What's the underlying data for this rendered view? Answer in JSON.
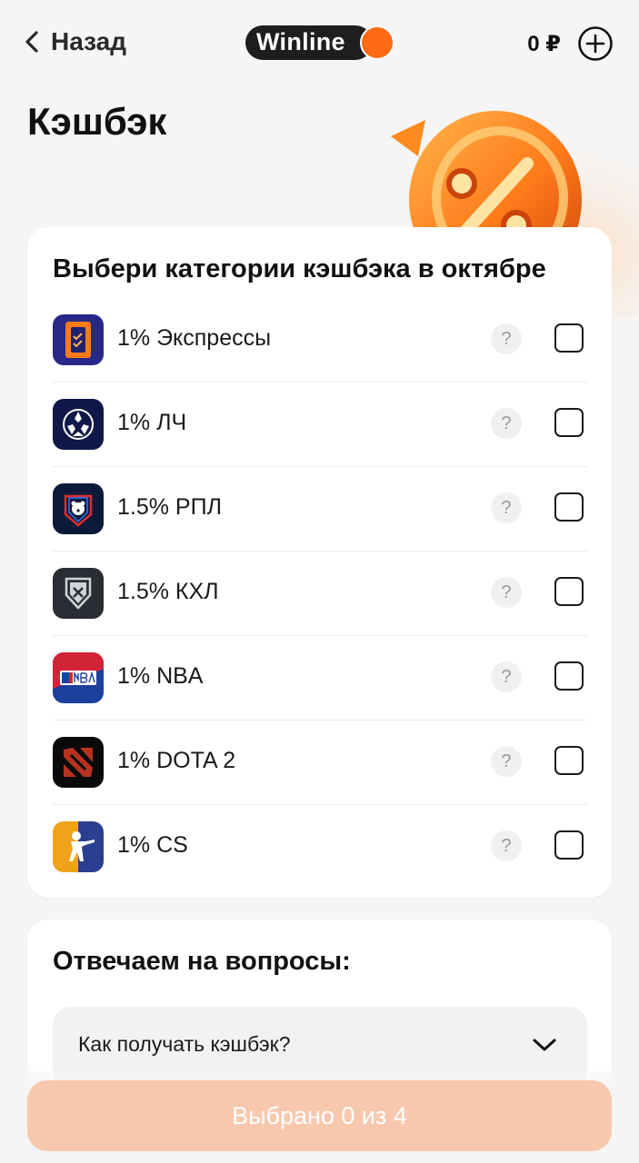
{
  "header": {
    "back_label": "Назад",
    "logo_text": "Winline",
    "balance": "0 ₽",
    "colors": {
      "brand_orange": "#ff6a13",
      "logo_bg": "#1e1e1e"
    }
  },
  "page_title": "Кэшбэк",
  "categories_card": {
    "title": "Выбери категории кэшбэка в октябре",
    "help_symbol": "?",
    "items": [
      {
        "label": "1% Экспрессы",
        "icon": "express-ticket-icon",
        "checked": false
      },
      {
        "label": "1% ЛЧ",
        "icon": "champions-league-icon",
        "checked": false
      },
      {
        "label": "1.5% РПЛ",
        "icon": "rpl-bear-icon",
        "checked": false
      },
      {
        "label": "1.5% КХЛ",
        "icon": "khl-shield-icon",
        "checked": false
      },
      {
        "label": "1% NBA",
        "icon": "nba-logo-icon",
        "checked": false
      },
      {
        "label": "1% DOTA 2",
        "icon": "dota2-logo-icon",
        "checked": false
      },
      {
        "label": "1% CS",
        "icon": "cs-soldier-icon",
        "checked": false
      }
    ]
  },
  "faq": {
    "title": "Отвечаем на вопросы:",
    "items": [
      {
        "question": "Как получать кэшбэк?"
      }
    ]
  },
  "cta": {
    "label": "Выбрано 0 из 4",
    "color": "#f8c8ae"
  }
}
